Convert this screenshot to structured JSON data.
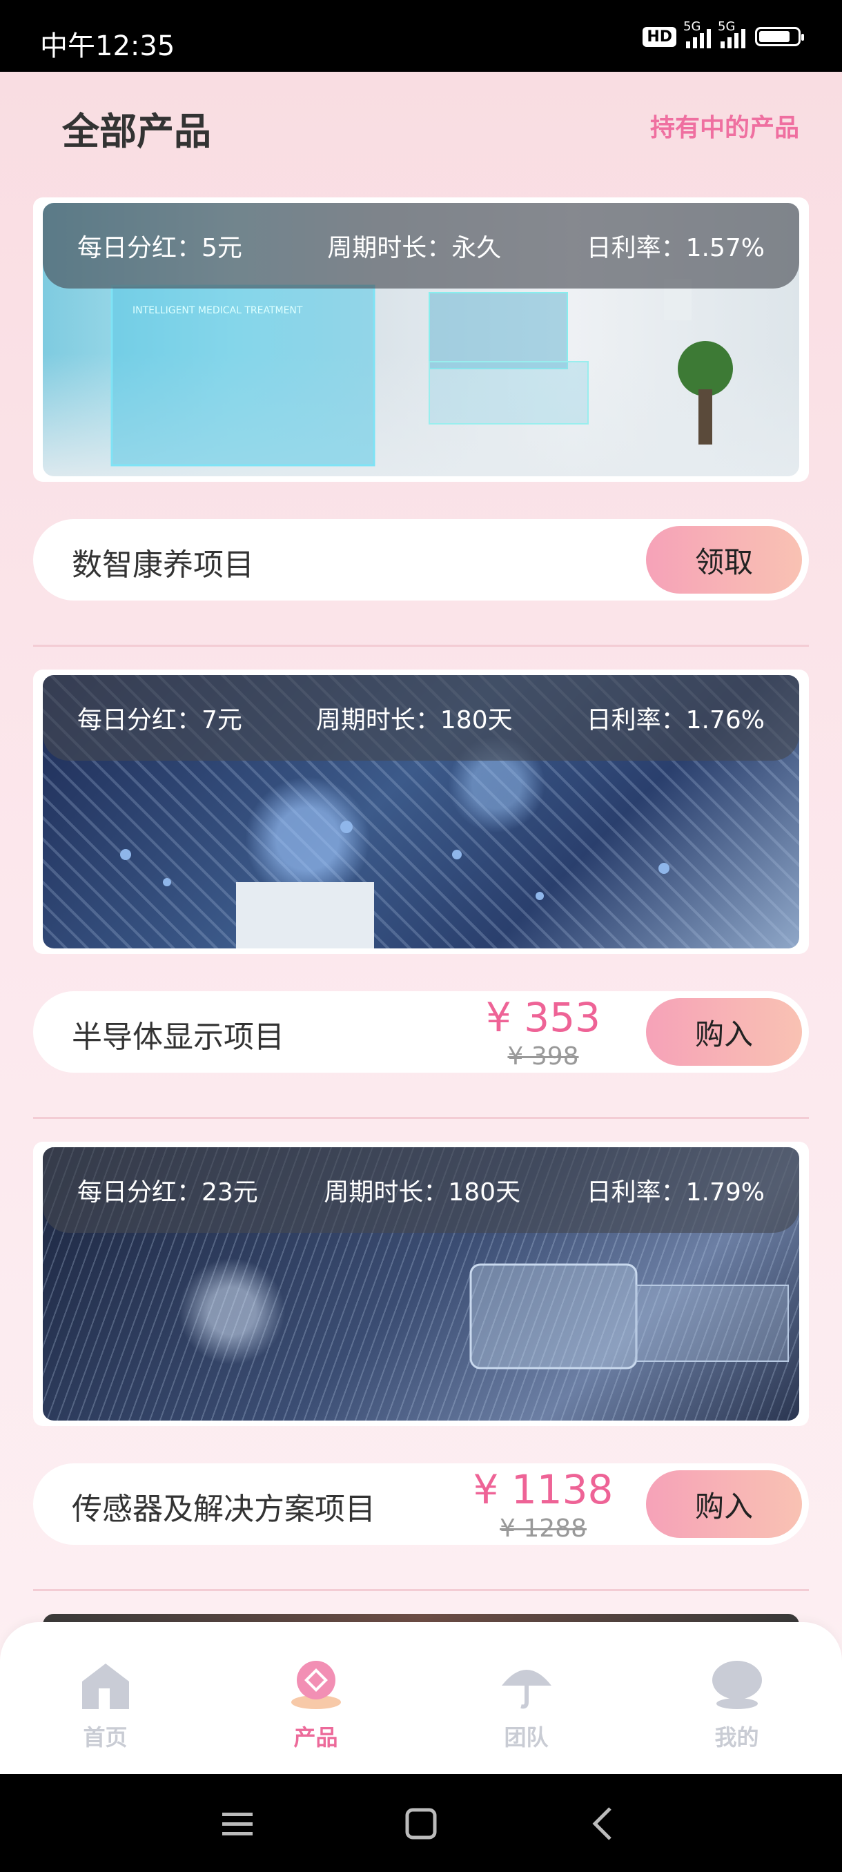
{
  "status_bar": {
    "time": "中午12:35",
    "hd": "HD",
    "network_1": "5G",
    "network_2": "5G"
  },
  "header": {
    "title": "全部产品",
    "holding_link": "持有中的产品"
  },
  "products": [
    {
      "dividend": "每日分红：5元",
      "period": "周期时长：永久",
      "rate": "日利率：1.57%",
      "banner_text": "INTELLIGENT MEDICAL TREATMENT",
      "name": "数智康养项目",
      "price": "",
      "old_price": "",
      "action": "领取"
    },
    {
      "dividend": "每日分红：7元",
      "period": "周期时长：180天",
      "rate": "日利率：1.76%",
      "name": "半导体显示项目",
      "price": "¥ 353",
      "old_price": "¥ 398",
      "action": "购入"
    },
    {
      "dividend": "每日分红：23元",
      "period": "周期时长：180天",
      "rate": "日利率：1.79%",
      "name": "传感器及解决方案项目",
      "price": "¥ 1138",
      "old_price": "¥ 1288",
      "action": "购入"
    }
  ],
  "tabs": [
    {
      "label": "首页",
      "icon": "home-icon"
    },
    {
      "label": "产品",
      "icon": "product-icon",
      "active": true
    },
    {
      "label": "团队",
      "icon": "team-icon"
    },
    {
      "label": "我的",
      "icon": "profile-icon"
    }
  ],
  "colors": {
    "accent": "#ec6a9a",
    "button_from": "#f6a2b8",
    "button_to": "#f9c2b3"
  }
}
